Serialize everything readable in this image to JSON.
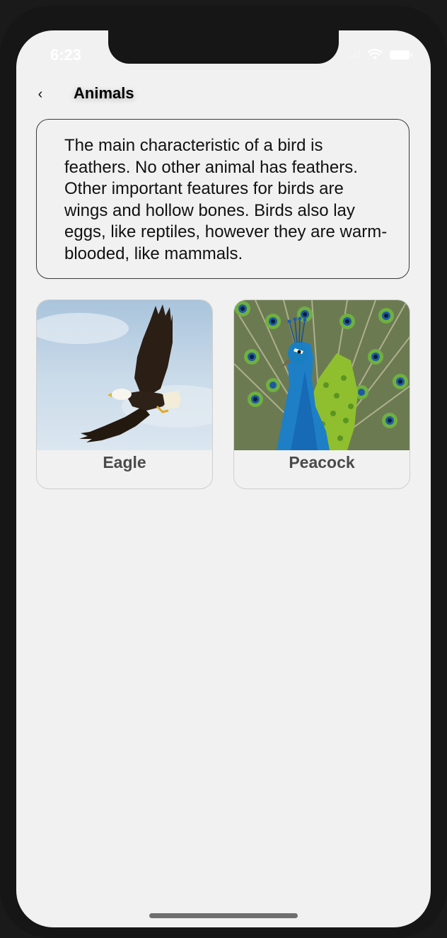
{
  "status_bar": {
    "time": "6:23"
  },
  "nav": {
    "back_symbol": "‹",
    "title": "Animals"
  },
  "description": "The main characteristic of a bird is feathers. No other animal has feathers. Other important features for birds are wings and hollow bones. Birds also lay eggs, like reptiles, however they are warm-blooded, like mammals.",
  "cards": [
    {
      "label": "Eagle",
      "image": "eagle-photo"
    },
    {
      "label": "Peacock",
      "image": "peacock-photo"
    }
  ],
  "colors": {
    "screen_background": "#f1f1f1",
    "card_label": "#4a4a4a",
    "bezel": "#161616"
  }
}
